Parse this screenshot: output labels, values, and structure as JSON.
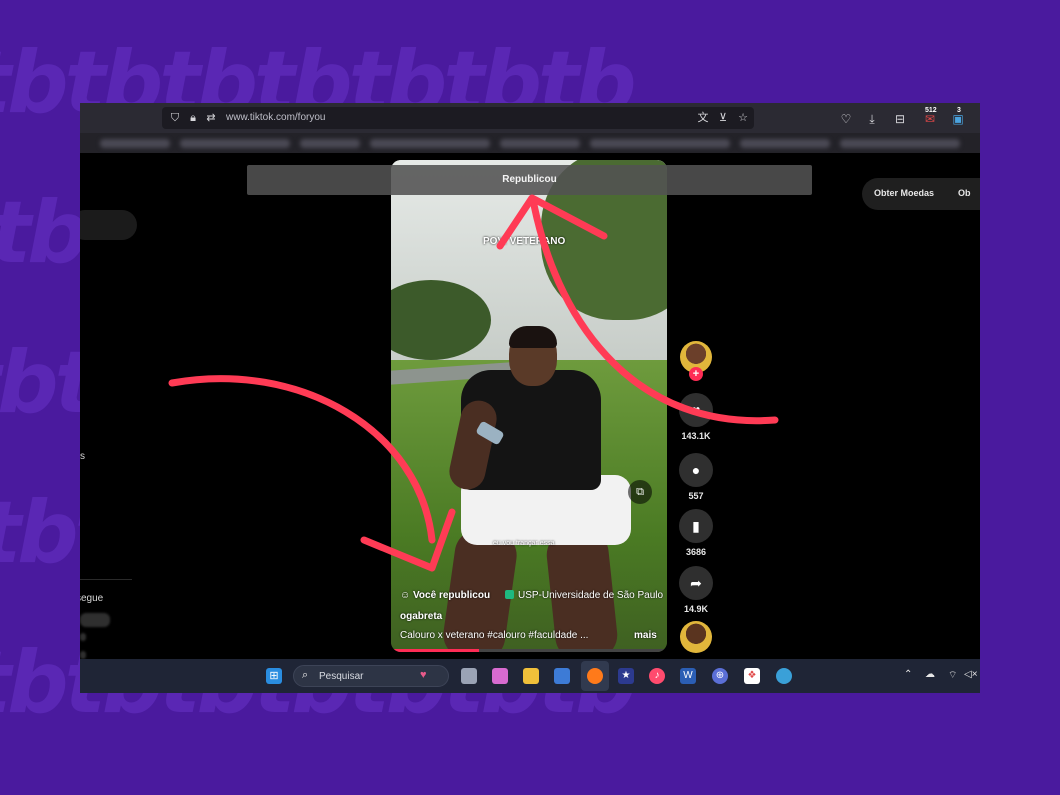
{
  "browser": {
    "url": "www.tiktok.com/foryou",
    "badge_mail": "512",
    "badge_ext": "3"
  },
  "tiktok": {
    "banner": "Republicou",
    "coins_label": "Obter Moedas",
    "coins_label2": "Ob",
    "left_s": "s",
    "left_segue": "segue",
    "video": {
      "overlay_text": "POV: VETERANO",
      "small_caption": "eu vou trançar essa",
      "reposted_label": "Você republicou",
      "location": "USP-Universidade de São Paulo",
      "username": "ogabreta",
      "description": "Calouro x veterano #calouro #faculdade ...",
      "more": "mais",
      "progress": 0.32
    },
    "actions": {
      "likes": "143.1K",
      "comments": "557",
      "saves": "3686",
      "shares": "14.9K"
    }
  },
  "taskbar": {
    "search_placeholder": "Pesquisar"
  },
  "colors": {
    "background": "#4a1a9e",
    "arrow": "#ff3b55",
    "tiktok_red": "#fe2c55"
  }
}
